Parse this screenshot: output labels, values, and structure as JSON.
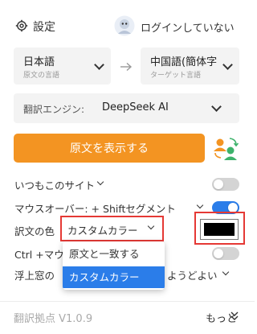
{
  "header": {
    "settings_label": "設定",
    "login_label": "ログインしていない"
  },
  "source_lang": {
    "value": "日本語",
    "caption": "原文の言語"
  },
  "target_lang": {
    "value": "中国語(簡体字",
    "caption": "ターゲット言語"
  },
  "engine": {
    "label": "翻訳エンジン:",
    "value": "DeepSeek AI"
  },
  "show_original_button": "原文を表示する",
  "rows": {
    "always_site": "いつもこのサイト",
    "mouseover": "マウスオーバー: + Shiftセグメント",
    "translation_color": "訳文の色",
    "ctrl_mouse": "Ctrl +マウ",
    "float_window": "浮上窓の",
    "float_window_tail": "ようどよい"
  },
  "toggles": {
    "always_site": false,
    "mouseover": true,
    "ctrl_mouse": false
  },
  "color_select": {
    "value": "カスタムカラー",
    "options": [
      "原文と一致する",
      "カスタムカラー"
    ],
    "swatch_color": "#000000"
  },
  "footer": {
    "version": "翻訳拠点 V1.0.9",
    "more": "もっと"
  },
  "colors": {
    "accent": "#f39422",
    "toggle_on": "#2b7de9",
    "highlight": "#e53935"
  }
}
